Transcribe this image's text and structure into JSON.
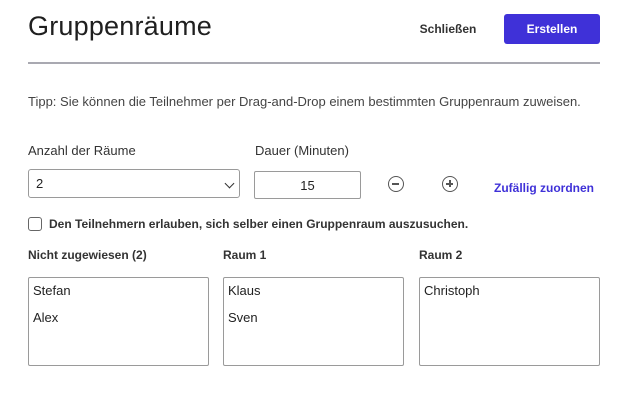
{
  "header": {
    "title": "Gruppenräume",
    "close_label": "Schließen",
    "create_label": "Erstellen"
  },
  "hint": "Tipp: Sie können die Teilnehmer per Drag-and-Drop einem bestimmten Gruppenraum zuweisen.",
  "rooms_count": {
    "label": "Anzahl der Räume",
    "value": "2"
  },
  "duration": {
    "label": "Dauer (Minuten)",
    "value": "15"
  },
  "random_assign_label": "Zufällig zuordnen",
  "self_select": {
    "label": "Den Teilnehmern erlauben, sich selber einen Gruppenraum auszusuchen.",
    "checked": false
  },
  "columns": [
    {
      "title": "Nicht zugewiesen (2)",
      "members": [
        "Stefan",
        "Alex"
      ]
    },
    {
      "title": "Raum 1",
      "members": [
        "Klaus",
        "Sven"
      ]
    },
    {
      "title": "Raum 2",
      "members": [
        "Christoph"
      ]
    }
  ],
  "colors": {
    "accent": "#3f31d8",
    "divider": "#a9a9b1"
  }
}
